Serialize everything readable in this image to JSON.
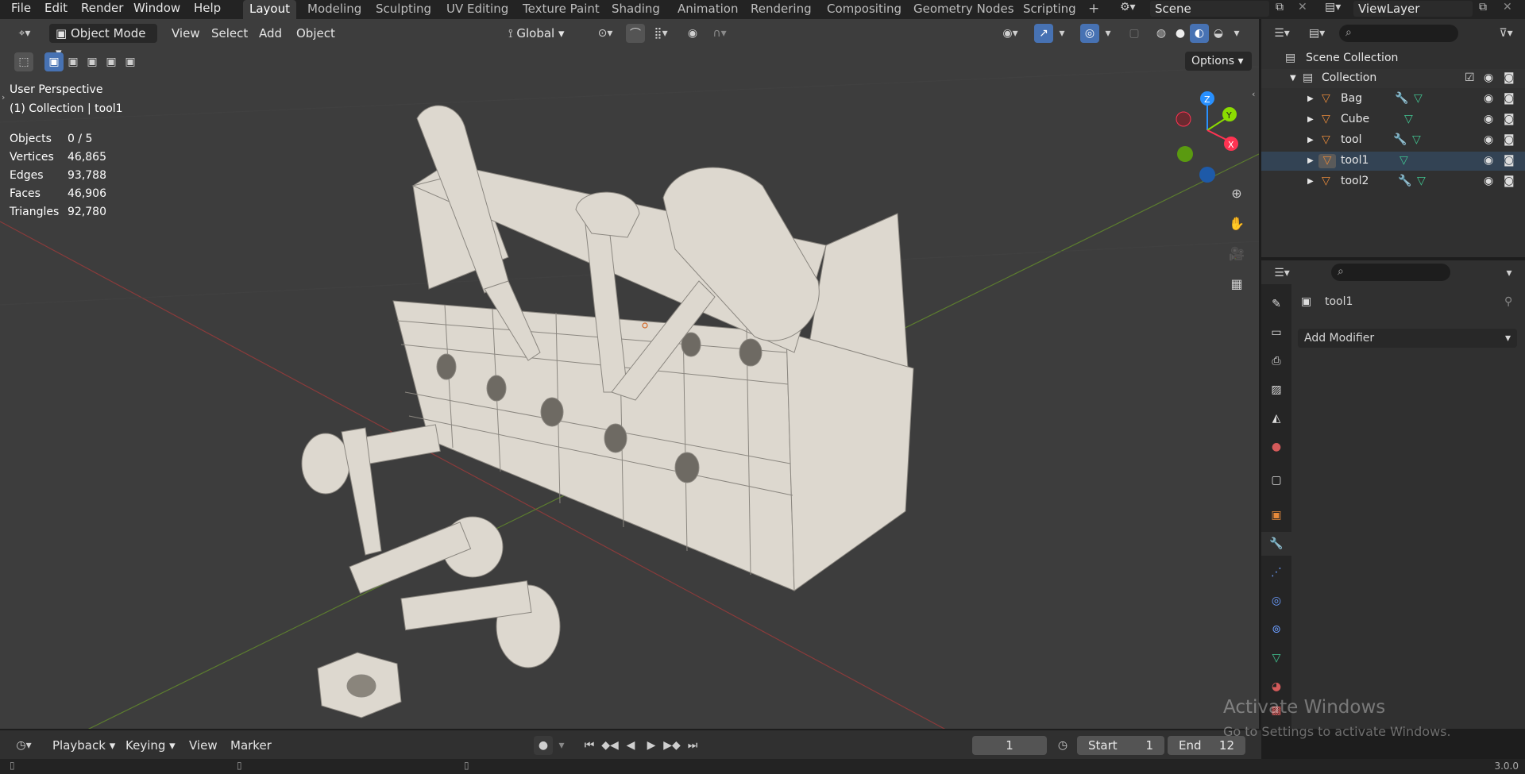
{
  "menu": {
    "file": "File",
    "edit": "Edit",
    "render": "Render",
    "window": "Window",
    "help": "Help"
  },
  "workspaces": [
    "Layout",
    "Modeling",
    "Sculpting",
    "UV Editing",
    "Texture Paint",
    "Shading",
    "Animation",
    "Rendering",
    "Compositing",
    "Geometry Nodes",
    "Scripting"
  ],
  "active_workspace": "Layout",
  "add_workspace": "+",
  "scene": {
    "label": "Scene"
  },
  "view_layer": {
    "label": "ViewLayer"
  },
  "viewport_header": {
    "mode": "Object Mode",
    "view": "View",
    "select": "Select",
    "add": "Add",
    "object": "Object",
    "transform_orientation": "Global",
    "options": "Options"
  },
  "viewport_overlay": {
    "perspective": "User Perspective",
    "context": "(1) Collection | tool1"
  },
  "stats": {
    "rows": [
      {
        "label": "Objects",
        "value": "0 / 5"
      },
      {
        "label": "Vertices",
        "value": "46,865"
      },
      {
        "label": "Edges",
        "value": "93,788"
      },
      {
        "label": "Faces",
        "value": "46,906"
      },
      {
        "label": "Triangles",
        "value": "92,780"
      }
    ]
  },
  "gizmo": {
    "x": "X",
    "y": "Y",
    "z": "Z"
  },
  "outliner": {
    "scene_collection": "Scene Collection",
    "collection": "Collection",
    "items": [
      {
        "name": "Bag",
        "has_modifier": true
      },
      {
        "name": "Cube",
        "has_modifier": false
      },
      {
        "name": "tool",
        "has_modifier": true
      },
      {
        "name": "tool1",
        "has_modifier": false,
        "active": true
      },
      {
        "name": "tool2",
        "has_modifier": true
      }
    ]
  },
  "properties": {
    "object_name": "tool1",
    "add_modifier": "Add Modifier"
  },
  "timeline": {
    "playback": "Playback",
    "keying": "Keying",
    "view": "View",
    "marker": "Marker",
    "current_frame": "1",
    "start_label": "Start",
    "start": "1",
    "end_label": "End",
    "end": "12"
  },
  "status": {
    "version": "3.0.0"
  },
  "watermark": {
    "title": "Activate Windows",
    "subtitle": "Go to Settings to activate Windows."
  },
  "colors": {
    "accent_blue": "#4772b3",
    "axis_x": "#ff3352",
    "axis_y": "#8bdc00",
    "axis_z": "#2890ff",
    "object_orange": "#e6893a",
    "modifier_blue": "#6b9dff",
    "mesh_green": "#41c491"
  }
}
